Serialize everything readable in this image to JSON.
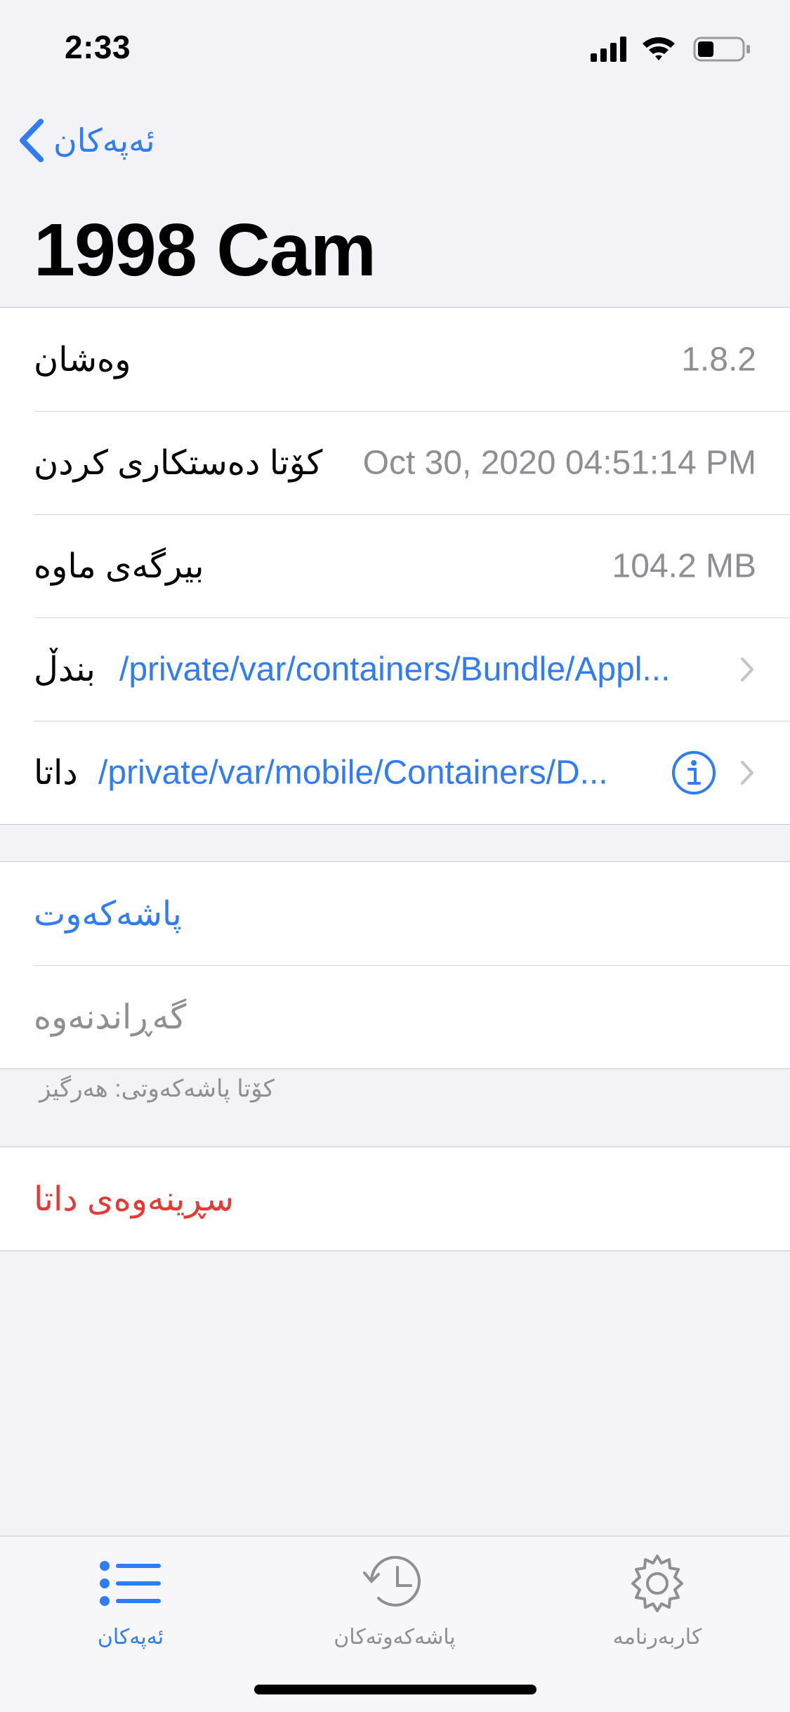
{
  "status_bar": {
    "time": "2:33"
  },
  "nav": {
    "back_label": "ئەپەکان"
  },
  "title": "1998 Cam",
  "info_rows": [
    {
      "label": "وەشان",
      "value": "1.8.2"
    },
    {
      "label": "کۆتا دەستکاری کردن",
      "value": "Oct 30, 2020 04:51:14 PM"
    },
    {
      "label": "بیرگەی ماوە",
      "value": "104.2 MB"
    },
    {
      "label": "بندڵ",
      "value": "/private/var/containers/Bundle/Appl..."
    },
    {
      "label": "داتا",
      "value": "/private/var/mobile/Containers/D..."
    }
  ],
  "actions": {
    "backup": "پاشەکەوت",
    "restore": "گەڕاندنەوە",
    "footer": "کۆتا پاشەکەوتی: هەرگیز",
    "delete": "سڕینەوەی داتا"
  },
  "tabs": [
    {
      "label": "ئەپەکان",
      "icon": "list-icon",
      "active": true
    },
    {
      "label": "پاشەکەوتەکان",
      "icon": "history-icon",
      "active": false
    },
    {
      "label": "کاربەرنامە",
      "icon": "gear-icon",
      "active": false
    }
  ],
  "colors": {
    "accent": "#2f7cf6",
    "destructive": "#e53935",
    "secondary": "#8e8e93",
    "background": "#f2f2f7"
  }
}
